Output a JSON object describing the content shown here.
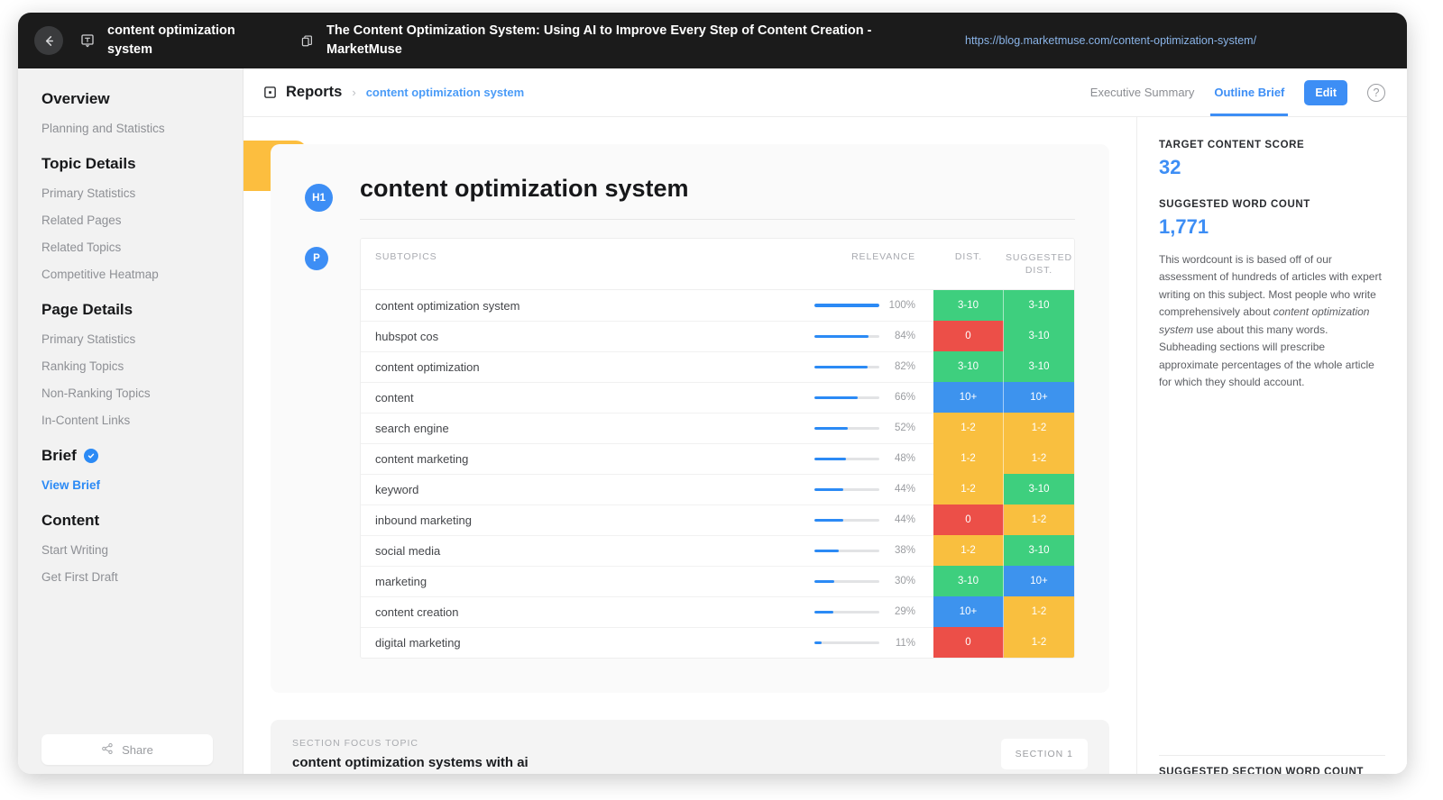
{
  "topbar": {
    "back_icon": "arrow-left-icon",
    "topic_icon": "topic-tag-icon",
    "topic": "content optimization system",
    "page_icon": "page-copy-icon",
    "page_title": "The Content Optimization System: Using AI to Improve Every Step of Content Creation - MarketMuse",
    "url": "https://blog.marketmuse.com/content-optimization-system/"
  },
  "sidebar": {
    "groups": [
      {
        "heading": "Overview",
        "items": [
          {
            "label": "Planning and Statistics",
            "active": false
          }
        ]
      },
      {
        "heading": "Topic Details",
        "items": [
          {
            "label": "Primary Statistics",
            "active": false
          },
          {
            "label": "Related Pages",
            "active": false
          },
          {
            "label": "Related Topics",
            "active": false
          },
          {
            "label": "Competitive Heatmap",
            "active": false
          }
        ]
      },
      {
        "heading": "Page Details",
        "items": [
          {
            "label": "Primary Statistics",
            "active": false
          },
          {
            "label": "Ranking Topics",
            "active": false
          },
          {
            "label": "Non-Ranking Topics",
            "active": false
          },
          {
            "label": "In-Content Links",
            "active": false
          }
        ]
      },
      {
        "heading": "Brief",
        "badge": "verified-check-icon",
        "items": [
          {
            "label": "View Brief",
            "active": true
          }
        ]
      },
      {
        "heading": "Content",
        "items": [
          {
            "label": "Start Writing",
            "active": false
          },
          {
            "label": "Get First Draft",
            "active": false
          }
        ]
      }
    ],
    "share_label": "Share",
    "share_icon": "share-nodes-icon"
  },
  "header": {
    "reports_icon": "reports-grid-icon",
    "breadcrumb_root": "Reports",
    "breadcrumb_separator": "›",
    "breadcrumb_current": "content optimization system",
    "tabs": [
      {
        "label": "Executive Summary",
        "active": false
      },
      {
        "label": "Outline Brief",
        "active": true
      }
    ],
    "edit_label": "Edit",
    "help_icon": "question-circle-icon",
    "help_glyph": "?"
  },
  "document": {
    "h1_badge": "H1",
    "h1_text": "content optimization system",
    "p_badge": "P",
    "section_card": {
      "label": "SECTION FOCUS TOPIC",
      "title": "content optimization systems with ai",
      "pill": "SECTION 1"
    }
  },
  "chart_data": {
    "type": "table",
    "title": "content optimization system",
    "columns": [
      "SUBTOPICS",
      "RELEVANCE",
      "DIST.",
      "SUGGESTED DIST."
    ],
    "rows": [
      {
        "subtopic": "content optimization system",
        "relevance": 100,
        "relevance_label": "100%",
        "dist": "3-10",
        "dist_color": "#3ecf7e",
        "sdist": "3-10",
        "sdist_color": "#3ecf7e"
      },
      {
        "subtopic": "hubspot cos",
        "relevance": 84,
        "relevance_label": "84%",
        "dist": "0",
        "dist_color": "#ec4f48",
        "sdist": "3-10",
        "sdist_color": "#3ecf7e"
      },
      {
        "subtopic": "content optimization",
        "relevance": 82,
        "relevance_label": "82%",
        "dist": "3-10",
        "dist_color": "#3ecf7e",
        "sdist": "3-10",
        "sdist_color": "#3ecf7e"
      },
      {
        "subtopic": "content",
        "relevance": 66,
        "relevance_label": "66%",
        "dist": "10+",
        "dist_color": "#3d93ee",
        "sdist": "10+",
        "sdist_color": "#3d93ee"
      },
      {
        "subtopic": "search engine",
        "relevance": 52,
        "relevance_label": "52%",
        "dist": "1-2",
        "dist_color": "#f9bf3f",
        "sdist": "1-2",
        "sdist_color": "#f9bf3f"
      },
      {
        "subtopic": "content marketing",
        "relevance": 48,
        "relevance_label": "48%",
        "dist": "1-2",
        "dist_color": "#f9bf3f",
        "sdist": "1-2",
        "sdist_color": "#f9bf3f"
      },
      {
        "subtopic": "keyword",
        "relevance": 44,
        "relevance_label": "44%",
        "dist": "1-2",
        "dist_color": "#f9bf3f",
        "sdist": "3-10",
        "sdist_color": "#3ecf7e"
      },
      {
        "subtopic": "inbound marketing",
        "relevance": 44,
        "relevance_label": "44%",
        "dist": "0",
        "dist_color": "#ec4f48",
        "sdist": "1-2",
        "sdist_color": "#f9bf3f"
      },
      {
        "subtopic": "social media",
        "relevance": 38,
        "relevance_label": "38%",
        "dist": "1-2",
        "dist_color": "#f9bf3f",
        "sdist": "3-10",
        "sdist_color": "#3ecf7e"
      },
      {
        "subtopic": "marketing",
        "relevance": 30,
        "relevance_label": "30%",
        "dist": "3-10",
        "dist_color": "#3ecf7e",
        "sdist": "10+",
        "sdist_color": "#3d93ee"
      },
      {
        "subtopic": "content creation",
        "relevance": 29,
        "relevance_label": "29%",
        "dist": "10+",
        "dist_color": "#3d93ee",
        "sdist": "1-2",
        "sdist_color": "#f9bf3f"
      },
      {
        "subtopic": "digital marketing",
        "relevance": 11,
        "relevance_label": "11%",
        "dist": "0",
        "dist_color": "#ec4f48",
        "sdist": "1-2",
        "sdist_color": "#f9bf3f"
      }
    ],
    "xlabel": "",
    "ylabel": "Relevance",
    "ylim": [
      0,
      100
    ]
  },
  "right_panel": {
    "score_label": "TARGET CONTENT SCORE",
    "score_value": "32",
    "wordcount_label": "SUGGESTED WORD COUNT",
    "wordcount_value": "1,771",
    "note_part1": "This wordcount is is based off of our assessment of hundreds of articles with expert writing on this subject. Most people who write comprehensively about ",
    "note_emphasis": "content optimization system",
    "note_part2": " use about this many words. Subheading sections will prescribe approximate percentages of the whole article for which they should account.",
    "bottom_label": "SUGGESTED SECTION WORD COUNT"
  }
}
